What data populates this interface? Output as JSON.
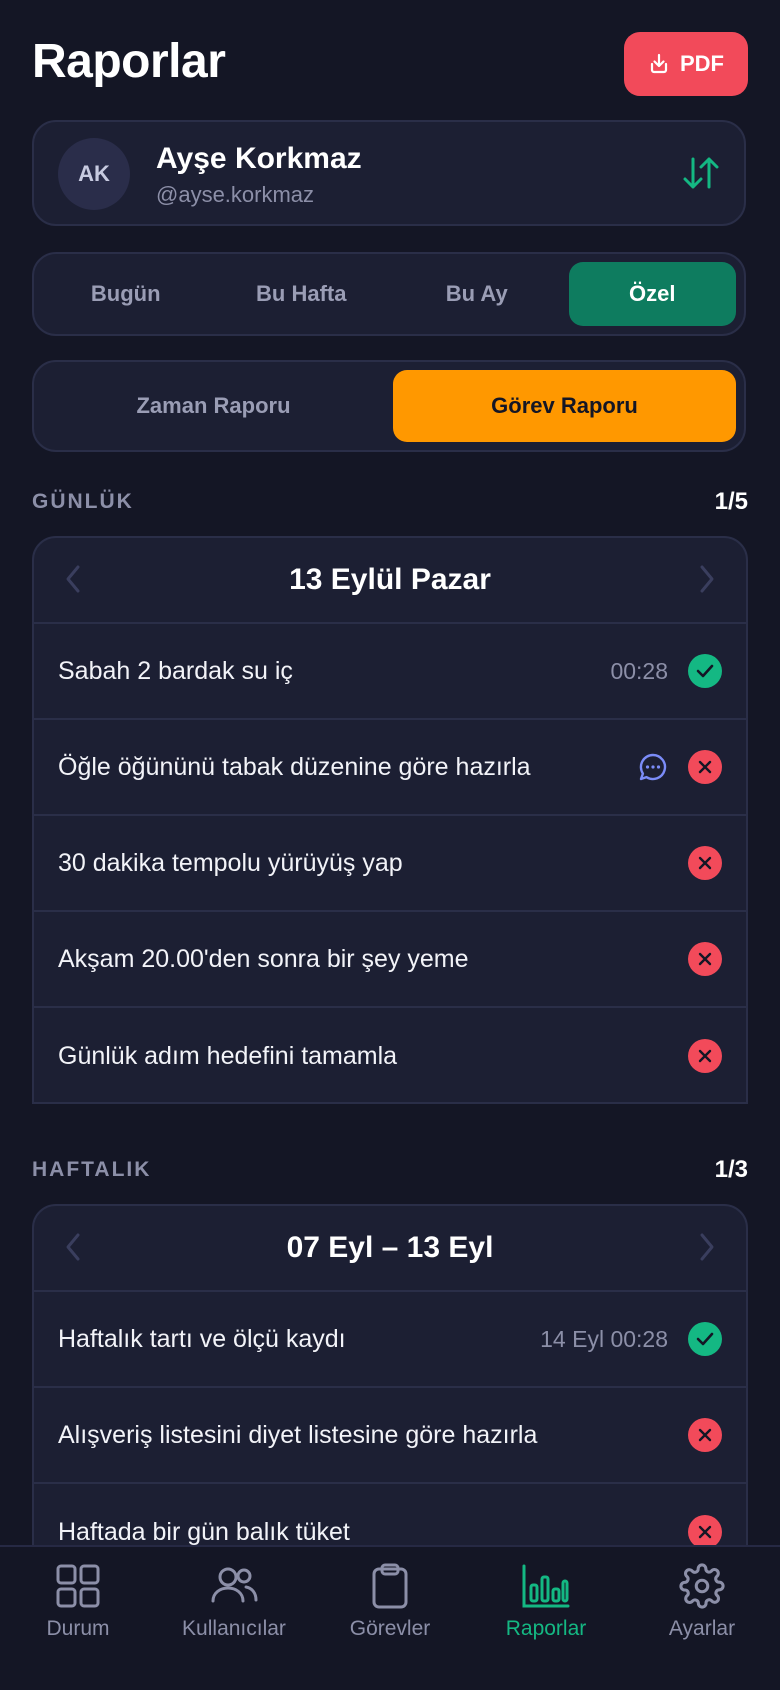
{
  "header": {
    "title": "Raporlar",
    "pdf_label": "PDF"
  },
  "user": {
    "initials": "AK",
    "name": "Ayşe Korkmaz",
    "handle": "@ayse.korkmaz"
  },
  "period_tabs": [
    {
      "label": "Bugün",
      "active": false
    },
    {
      "label": "Bu Hafta",
      "active": false
    },
    {
      "label": "Bu Ay",
      "active": false
    },
    {
      "label": "Özel",
      "active": true
    }
  ],
  "report_tabs": [
    {
      "label": "Zaman Raporu",
      "active": false
    },
    {
      "label": "Görev Raporu",
      "active": true
    }
  ],
  "daily": {
    "label": "GÜNLÜK",
    "count": "1/5",
    "date": "13 Eylül Pazar",
    "tasks": [
      {
        "text": "Sabah 2 bardak su iç",
        "time": "00:28",
        "status": "done",
        "comment": false
      },
      {
        "text": "Öğle öğününü tabak düzenine göre hazırla",
        "time": "",
        "status": "fail",
        "comment": true
      },
      {
        "text": "30 dakika tempolu yürüyüş yap",
        "time": "",
        "status": "fail",
        "comment": false
      },
      {
        "text": "Akşam 20.00'den sonra bir şey yeme",
        "time": "",
        "status": "fail",
        "comment": false
      },
      {
        "text": "Günlük adım hedefini tamamla",
        "time": "",
        "status": "fail",
        "comment": false
      }
    ]
  },
  "weekly": {
    "label": "HAFTALIK",
    "count": "1/3",
    "date": "07 Eyl – 13 Eyl",
    "tasks": [
      {
        "text": "Haftalık tartı ve ölçü kaydı",
        "time": "14 Eyl 00:28",
        "status": "done",
        "comment": false
      },
      {
        "text": "Alışveriş listesini diyet listesine göre hazırla",
        "time": "",
        "status": "fail",
        "comment": false
      },
      {
        "text": "Haftada bir gün balık tüket",
        "time": "",
        "status": "fail",
        "comment": false
      }
    ]
  },
  "tabbar": [
    {
      "label": "Durum",
      "icon": "grid-icon",
      "active": false
    },
    {
      "label": "Kullanıcılar",
      "icon": "users-icon",
      "active": false
    },
    {
      "label": "Görevler",
      "icon": "clipboard-icon",
      "active": false
    },
    {
      "label": "Raporlar",
      "icon": "chart-icon",
      "active": true
    },
    {
      "label": "Ayarlar",
      "icon": "gear-icon",
      "active": false
    }
  ],
  "colors": {
    "background": "#141625",
    "card": "#1C1F33",
    "accent_green": "#14B883",
    "accent_orange": "#FF9800",
    "danger": "#F24A5A"
  }
}
